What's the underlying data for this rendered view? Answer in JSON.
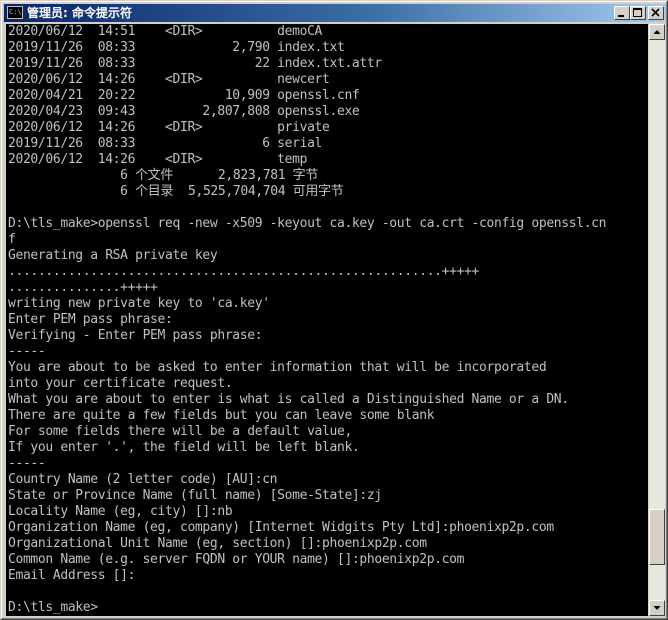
{
  "window": {
    "title": "管理员: 命令提示符",
    "icon": "cmd-icon",
    "icon_glyph": "C:\\"
  },
  "console": {
    "lines": [
      "2020/06/12  14:51    <DIR>          demoCA",
      "2019/11/26  08:33             2,790 index.txt",
      "2019/11/26  08:33                22 index.txt.attr",
      "2020/06/12  14:26    <DIR>          newcert",
      "2020/04/21  20:22            10,909 openssl.cnf",
      "2020/04/23  09:43         2,807,808 openssl.exe",
      "2020/06/12  14:26    <DIR>          private",
      "2019/11/26  08:33                 6 serial",
      "2020/06/12  14:26    <DIR>          temp",
      "               6 个文件      2,823,781 字节",
      "               6 个目录  5,525,704,704 可用字节",
      "",
      "D:\\tls_make>openssl req -new -x509 -keyout ca.key -out ca.crt -config openssl.cn",
      "f",
      "Generating a RSA private key",
      "..........................................................+++++",
      "...............+++++",
      "writing new private key to 'ca.key'",
      "Enter PEM pass phrase:",
      "Verifying - Enter PEM pass phrase:",
      "-----",
      "You are about to be asked to enter information that will be incorporated",
      "into your certificate request.",
      "What you are about to enter is what is called a Distinguished Name or a DN.",
      "There are quite a few fields but you can leave some blank",
      "For some fields there will be a default value,",
      "If you enter '.', the field will be left blank.",
      "-----",
      "Country Name (2 letter code) [AU]:cn",
      "State or Province Name (full name) [Some-State]:zj",
      "Locality Name (eg, city) []:nb",
      "Organization Name (eg, company) [Internet Widgits Pty Ltd]:phoenixp2p.com",
      "Organizational Unit Name (eg, section) []:phoenixp2p.com",
      "Common Name (e.g. server FQDN or YOUR name) []:phoenixp2p.com",
      "Email Address []:",
      "",
      "D:\\tls_make>"
    ]
  },
  "scrollbar": {
    "position": 0.93,
    "visible_fraction": 0.1
  },
  "colors": {
    "console_bg": "#000000",
    "console_fg": "#c0c0c0",
    "titlebar_start": "#0a246a",
    "titlebar_end": "#a6caf0"
  }
}
